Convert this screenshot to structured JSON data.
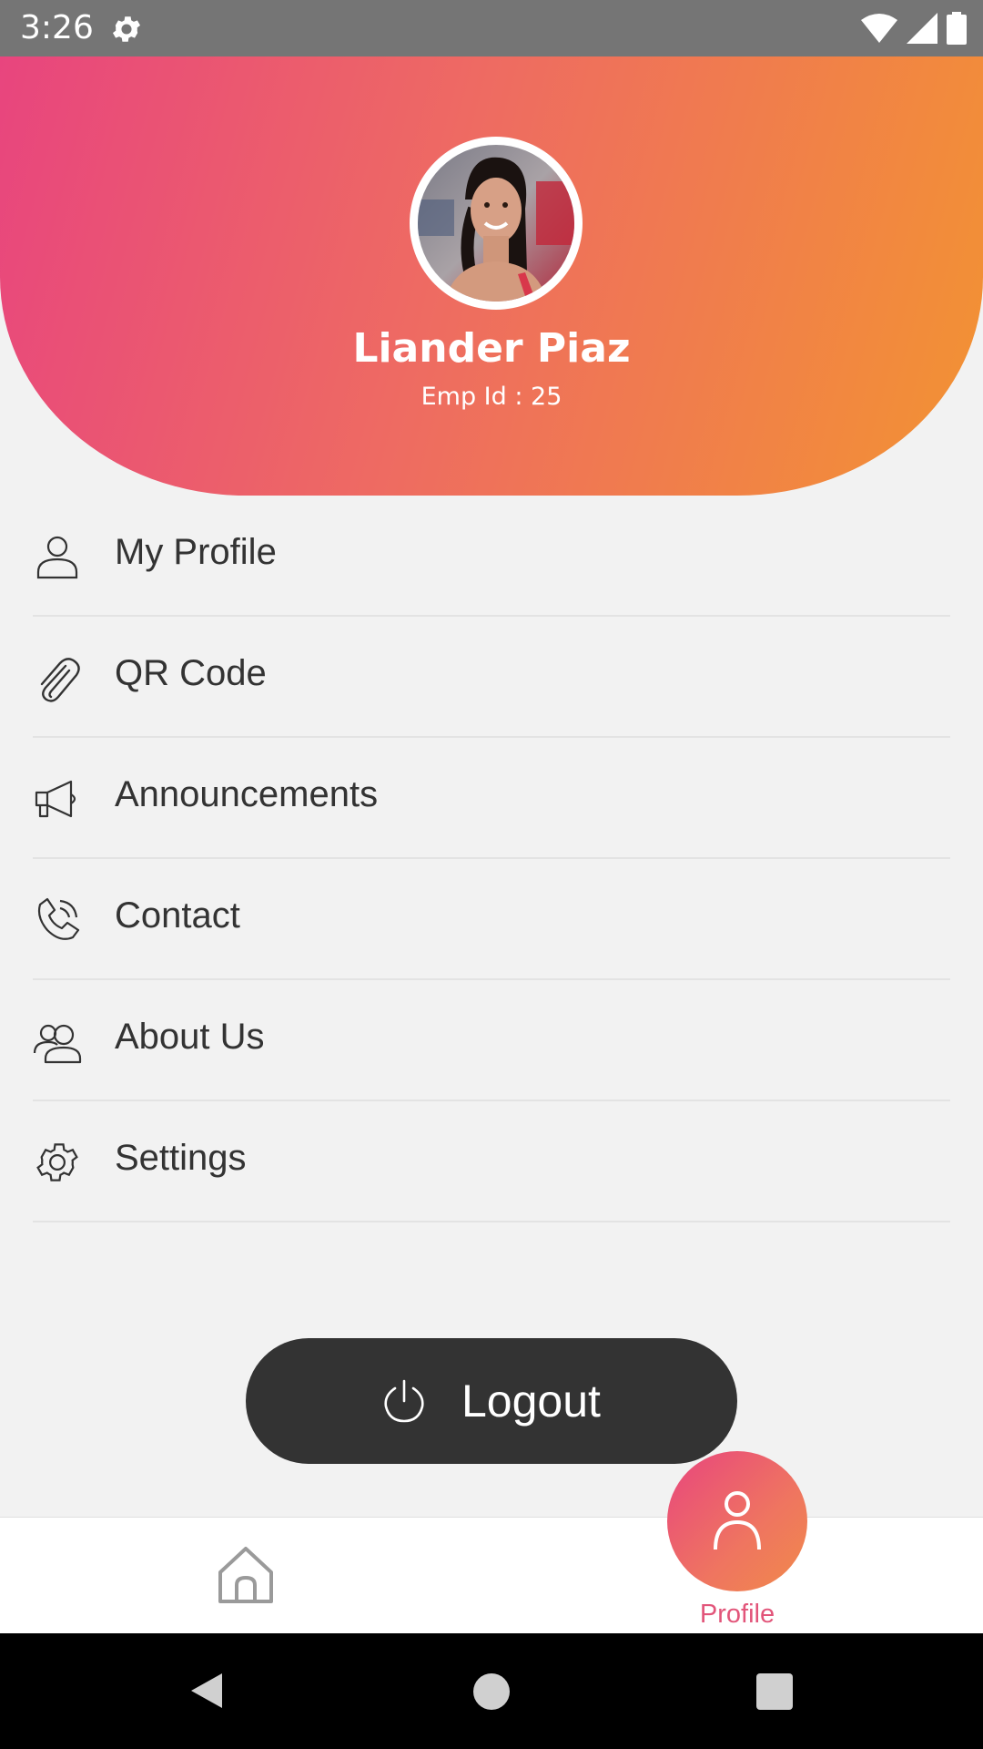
{
  "status_bar": {
    "time": "3:26",
    "icons": [
      "settings-icon",
      "wifi-icon",
      "signal-icon",
      "battery-icon"
    ]
  },
  "header": {
    "name": "Liander Piaz",
    "emp_id": "Emp Id : 25",
    "gradient": [
      "#e8457e",
      "#ee6b62",
      "#f39332"
    ]
  },
  "menu": {
    "items": [
      {
        "label": "My Profile",
        "icon": "person-icon"
      },
      {
        "label": "QR Code",
        "icon": "paperclip-icon"
      },
      {
        "label": "Announcements",
        "icon": "megaphone-icon"
      },
      {
        "label": "Contact",
        "icon": "phone-icon"
      },
      {
        "label": "About Us",
        "icon": "people-icon"
      },
      {
        "label": "Settings",
        "icon": "gear-icon"
      }
    ]
  },
  "logout": {
    "label": "Logout",
    "icon": "power-icon"
  },
  "bottom_nav": {
    "items": [
      {
        "label": "",
        "icon": "home-icon",
        "active": false
      },
      {
        "label": "Profile",
        "icon": "person-icon",
        "active": true
      }
    ],
    "active_color": "#e2557a"
  },
  "system_nav": {
    "icons": [
      "back-icon",
      "home-circle-icon",
      "recents-icon"
    ]
  }
}
